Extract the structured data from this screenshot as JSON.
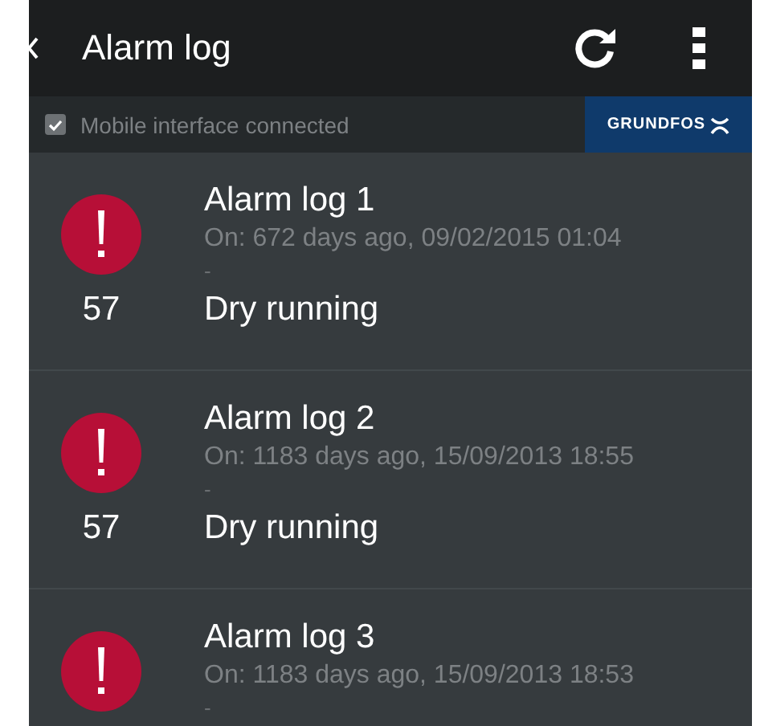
{
  "app_bar": {
    "title": "Alarm log"
  },
  "status": {
    "checked": true,
    "label": "Mobile interface connected",
    "brand": "GRUNDFOS"
  },
  "alarms": [
    {
      "title": "Alarm log 1",
      "time": "On: 672 days ago, 09/02/2015 01:04",
      "separator": "-",
      "code": "57",
      "message": "Dry running"
    },
    {
      "title": "Alarm log 2",
      "time": "On: 1183 days ago, 15/09/2013 18:55",
      "separator": "-",
      "code": "57",
      "message": "Dry running"
    },
    {
      "title": "Alarm log 3",
      "time": "On: 1183 days ago, 15/09/2013 18:53",
      "separator": "-"
    }
  ]
}
